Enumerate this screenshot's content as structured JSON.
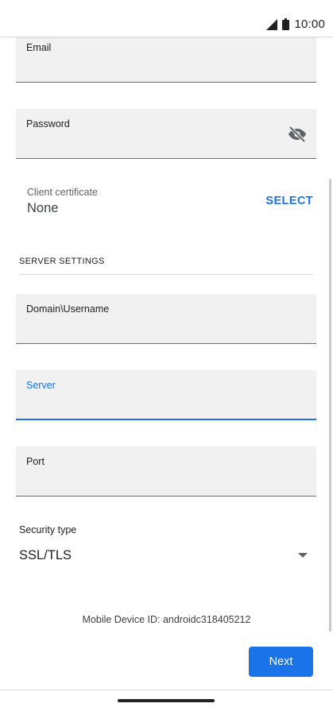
{
  "status_bar": {
    "time": "10:00",
    "signal_icon": "signal-icon",
    "battery_icon": "battery-icon"
  },
  "form": {
    "email": {
      "label": "Email",
      "value": ""
    },
    "password": {
      "label": "Password",
      "value": "",
      "toggle_icon": "visibility-off-icon"
    },
    "client_certificate": {
      "label": "Client certificate",
      "value": "None",
      "select_label": "SELECT"
    },
    "server_settings": {
      "title": "SERVER SETTINGS",
      "domain_username": {
        "label": "Domain\\Username",
        "value": ""
      },
      "server": {
        "label": "Server",
        "value": ""
      },
      "port": {
        "label": "Port",
        "value": ""
      },
      "security_type": {
        "label": "Security type",
        "value": "SSL/TLS",
        "dropdown_icon": "dropdown-arrow-icon"
      }
    }
  },
  "device_id": "Mobile Device ID: androidc318405212",
  "next_label": "Next",
  "colors": {
    "accent": "#1a73e8",
    "field_background": "#f1f1f1"
  }
}
